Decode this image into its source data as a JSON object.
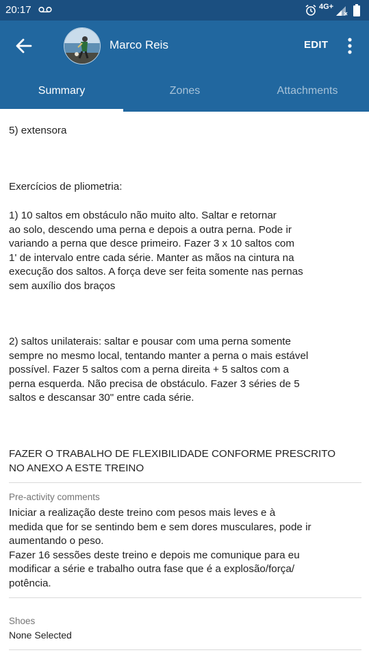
{
  "status_bar": {
    "time": "20:17",
    "network": "4G+"
  },
  "header": {
    "name": "Marco Reis",
    "edit_label": "EDIT"
  },
  "tabs": [
    {
      "label": "Summary",
      "active": true
    },
    {
      "label": "Zones",
      "active": false
    },
    {
      "label": "Attachments",
      "active": false
    }
  ],
  "summary": {
    "line_extensora": "5) extensora",
    "plyo_heading": "Exercícios de pliometria:",
    "exercise1": "1) 10 saltos em obstáculo não muito alto. Saltar e retornar\nao solo, descendo uma perna e depois a outra perna. Pode ir\nvariando a perna que desce primeiro. Fazer 3 x 10 saltos com\n1' de intervalo entre cada série. Manter as mãos na cintura na\nexecução dos saltos. A força deve ser feita somente nas pernas\nsem auxílio dos braços",
    "exercise2": "2) saltos unilaterais: saltar e pousar com uma perna somente\nsempre no mesmo local, tentando manter a perna o mais estável\npossível. Fazer 5 saltos com a perna direita + 5 saltos com a\nperna esquerda. Não precisa de obstáculo. Fazer 3 séries de 5\nsaltos e descansar 30\" entre cada série.",
    "flex_note": "FAZER O TRABALHO DE FLEXIBILIDADE CONFORME PRESCRITO\nNO ANEXO A ESTE TREINO"
  },
  "pre_activity": {
    "label": "Pre-activity comments",
    "text": "Iniciar a realização deste treino com pesos mais leves e à\nmedida que for se sentindo bem e sem dores musculares, pode ir\naumentando o peso.\nFazer 16 sessões deste treino e depois me comunique para eu\nmodificar a série e trabalho outra fase que é a explosão/força/\npotência."
  },
  "shoes": {
    "label": "Shoes",
    "value": "None Selected"
  },
  "colors": {
    "status_bar": "#1b4f80",
    "app_bar": "#21679f",
    "tab_indicator": "#ffffff"
  }
}
